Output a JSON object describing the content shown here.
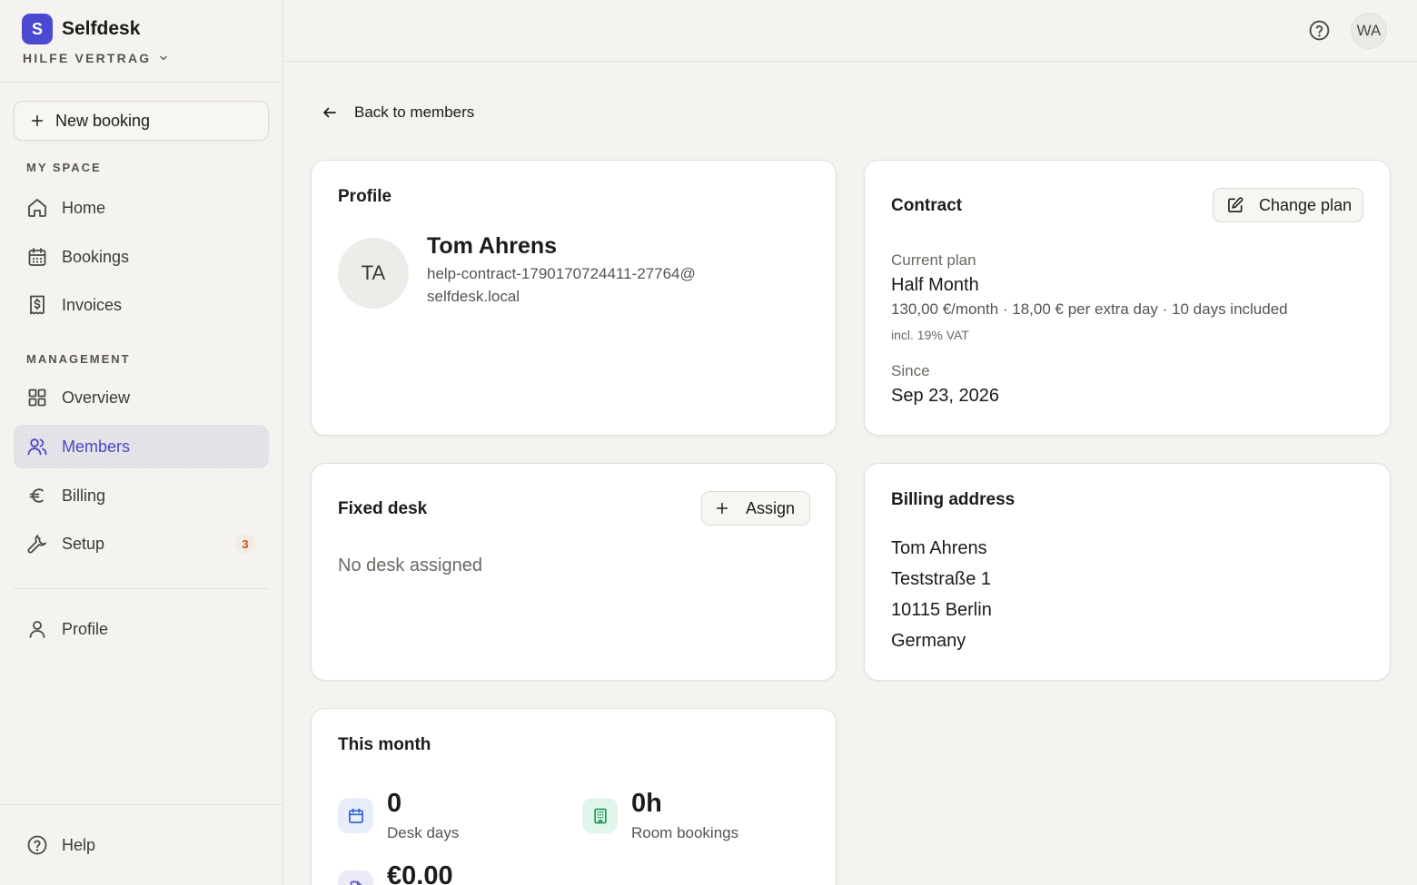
{
  "app": {
    "name": "Selfdesk",
    "logo_letter": "S",
    "workspace": "HILFE VERTRAG"
  },
  "sidebar": {
    "new_booking": "New booking",
    "my_space_label": "MY SPACE",
    "management_label": "MANAGEMENT",
    "items": [
      {
        "label": "Home",
        "icon": "home-icon"
      },
      {
        "label": "Bookings",
        "icon": "calendar-icon"
      },
      {
        "label": "Invoices",
        "icon": "receipt-icon"
      },
      {
        "label": "Overview",
        "icon": "grid-icon"
      },
      {
        "label": "Members",
        "icon": "users-icon",
        "active": true
      },
      {
        "label": "Billing",
        "icon": "euro-icon"
      },
      {
        "label": "Setup",
        "icon": "wrench-icon",
        "badge": "3"
      },
      {
        "label": "Profile",
        "icon": "user-icon"
      }
    ],
    "help": "Help"
  },
  "topbar": {
    "user_initials": "WA"
  },
  "main": {
    "back": "Back to members",
    "profile": {
      "title": "Profile",
      "initials": "TA",
      "name": "Tom Ahrens",
      "email": "help-contract-1790170724411-27764@selfdesk.local"
    },
    "contract": {
      "title": "Contract",
      "change_plan": "Change plan",
      "current_plan_label": "Current plan",
      "plan_name": "Half Month",
      "plan_details": "130,00 €/month · 18,00 € per extra day · 10 days included",
      "vat_note": "incl. 19% VAT",
      "since_label": "Since",
      "since_value": "Sep 23, 2026"
    },
    "fixed_desk": {
      "title": "Fixed desk",
      "assign": "Assign",
      "empty": "No desk assigned"
    },
    "billing_address": {
      "title": "Billing address",
      "lines": [
        "Tom Ahrens",
        "Teststraße 1",
        "10115 Berlin",
        "Germany"
      ]
    },
    "this_month": {
      "title": "This month",
      "stats": [
        {
          "value": "0",
          "label": "Desk days",
          "icon": "calendar-icon",
          "color": "#2f5fd0",
          "bg": "#e8eef9"
        },
        {
          "value": "0h",
          "label": "Room bookings",
          "icon": "building-icon",
          "color": "#1f9a5e",
          "bg": "#e1f5ea"
        },
        {
          "value": "€0.00",
          "label": "",
          "icon": "document-icon",
          "color": "#5b57c9",
          "bg": "#eceaf6"
        }
      ]
    }
  },
  "colors": {
    "accent": "#4a49d0",
    "background": "#f4f3f0",
    "badge_text": "#c9521a"
  }
}
